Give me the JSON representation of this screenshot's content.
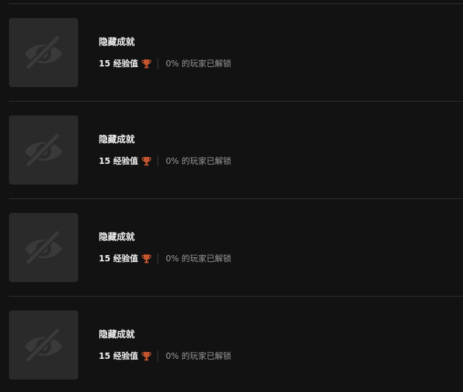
{
  "achievements": [
    {
      "title": "隐藏成就",
      "xp": "15 经验值",
      "unlock": "0% 的玩家已解锁",
      "icon": "hidden-eye-slash-icon",
      "trophy_icon": "bronze-trophy-icon"
    },
    {
      "title": "隐藏成就",
      "xp": "15 经验值",
      "unlock": "0% 的玩家已解锁",
      "icon": "hidden-eye-slash-icon",
      "trophy_icon": "bronze-trophy-icon"
    },
    {
      "title": "隐藏成就",
      "xp": "15 经验值",
      "unlock": "0% 的玩家已解锁",
      "icon": "hidden-eye-slash-icon",
      "trophy_icon": "bronze-trophy-icon"
    },
    {
      "title": "隐藏成就",
      "xp": "15 经验值",
      "unlock": "0% 的玩家已解锁",
      "icon": "hidden-eye-slash-icon",
      "trophy_icon": "bronze-trophy-icon"
    }
  ],
  "colors": {
    "background": "#121212",
    "thumbnail": "#2a2a2a",
    "trophy": "#c4552e",
    "divider": "#2f2f2f"
  }
}
